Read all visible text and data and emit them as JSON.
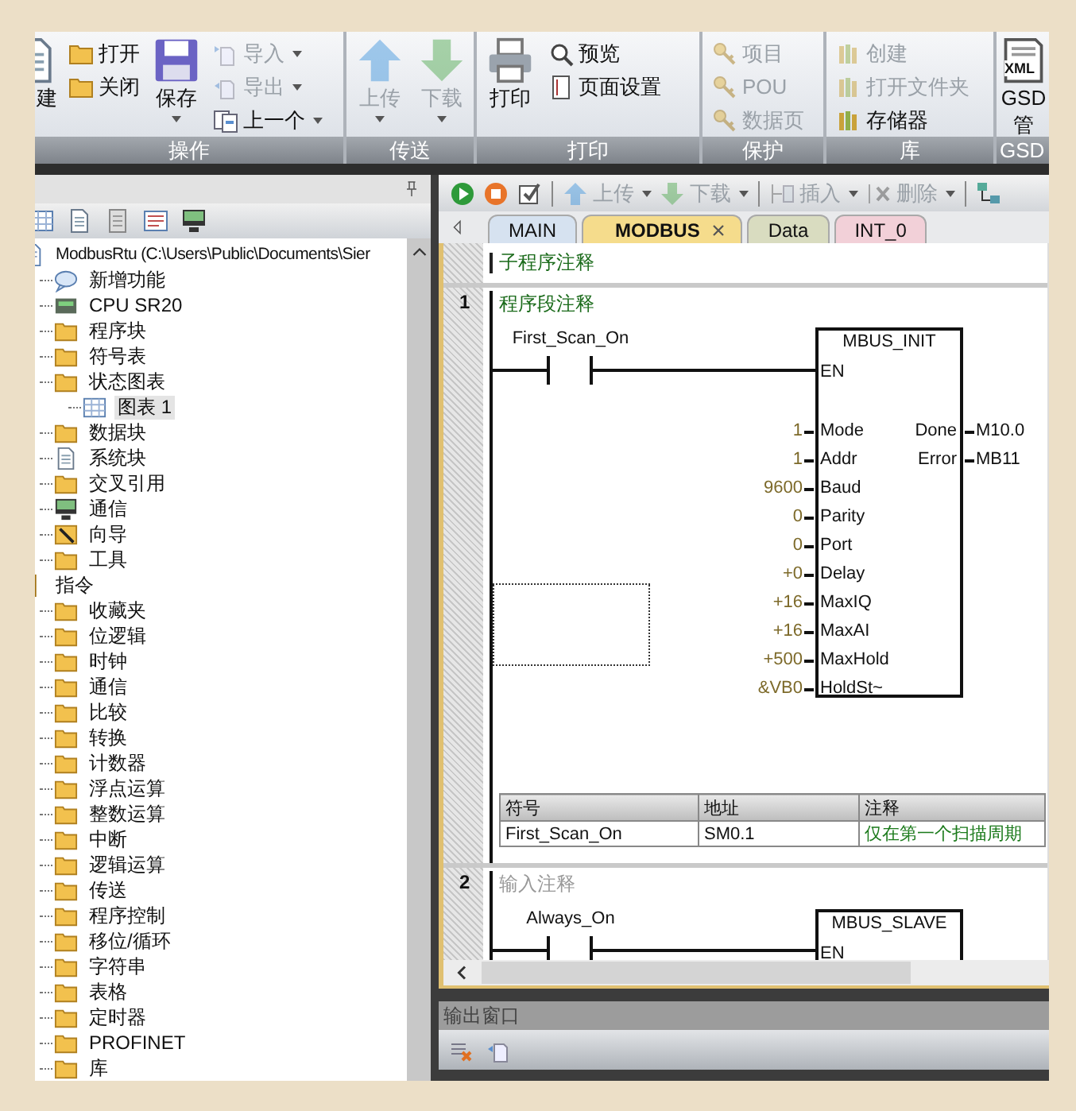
{
  "ribbon": {
    "groups": [
      {
        "label": "操作",
        "columns": [
          [
            {
              "kind": "document",
              "label": "建",
              "disabled": false,
              "dropdown": false
            }
          ],
          [
            {
              "kind": "folder",
              "label": "打开",
              "disabled": false,
              "dropdown": false
            },
            {
              "kind": "folder",
              "label": "关闭",
              "disabled": false,
              "dropdown": false
            }
          ],
          [
            {
              "kind": "save",
              "label": "保存",
              "disabled": false,
              "dropdown": true
            }
          ],
          [
            {
              "kind": "import",
              "label": "导入",
              "disabled": true,
              "dropdown": true
            },
            {
              "kind": "export",
              "label": "导出",
              "disabled": true,
              "dropdown": true
            },
            {
              "kind": "previous",
              "label": "上一个",
              "disabled": false,
              "dropdown": true
            }
          ]
        ]
      },
      {
        "label": "传送",
        "columns": [
          [
            {
              "kind": "upload",
              "label": "上传",
              "disabled": true,
              "dropdown": true
            }
          ],
          [
            {
              "kind": "download",
              "label": "下载",
              "disabled": true,
              "dropdown": true
            }
          ]
        ]
      },
      {
        "label": "打印",
        "columns": [
          [
            {
              "kind": "print",
              "label": "打印",
              "disabled": false,
              "dropdown": false
            }
          ],
          [
            {
              "kind": "preview",
              "label": "预览",
              "disabled": false,
              "dropdown": false
            },
            {
              "kind": "page_setup",
              "label": "页面设置",
              "disabled": false,
              "dropdown": false
            }
          ]
        ]
      },
      {
        "label": "保护",
        "columns": [
          [
            {
              "kind": "key",
              "label": "项目",
              "disabled": true,
              "dropdown": false
            },
            {
              "kind": "key",
              "label": "POU",
              "disabled": true,
              "dropdown": false
            },
            {
              "kind": "key",
              "label": "数据页",
              "disabled": true,
              "dropdown": false
            }
          ]
        ]
      },
      {
        "label": "库",
        "columns": [
          [
            {
              "kind": "books",
              "label": "创建",
              "disabled": true,
              "dropdown": false
            },
            {
              "kind": "books",
              "label": "打开文件夹",
              "disabled": true,
              "dropdown": false
            },
            {
              "kind": "books",
              "label": "存储器",
              "disabled": false,
              "dropdown": false
            }
          ]
        ]
      },
      {
        "label": "GSD",
        "columns": [
          [
            {
              "kind": "xml",
              "label": "GSD",
              "sublabel": "管",
              "badge": "XML",
              "disabled": false,
              "dropdown": false
            }
          ]
        ]
      }
    ]
  },
  "project_tree": {
    "items": [
      {
        "kind": "project",
        "label": "ModbusRtu (C:\\Users\\Public\\Documents\\Sier",
        "selected": false,
        "children": [
          {
            "kind": "help",
            "label": "新增功能",
            "selected": false
          },
          {
            "kind": "cpu",
            "label": "CPU SR20",
            "selected": false
          },
          {
            "kind": "folder",
            "label": "程序块",
            "selected": false
          },
          {
            "kind": "folder",
            "label": "符号表",
            "selected": false
          },
          {
            "kind": "folder",
            "label": "状态图表",
            "selected": false,
            "children": [
              {
                "kind": "table",
                "label": "图表 1",
                "selected": true
              }
            ]
          },
          {
            "kind": "folder",
            "label": "数据块",
            "selected": false
          },
          {
            "kind": "document",
            "label": "系统块",
            "selected": false
          },
          {
            "kind": "folder",
            "label": "交叉引用",
            "selected": false
          },
          {
            "kind": "monitor",
            "label": "通信",
            "selected": false
          },
          {
            "kind": "wand",
            "label": "向导",
            "selected": false
          },
          {
            "kind": "folder",
            "label": "工具",
            "selected": false
          }
        ]
      },
      {
        "kind": "category",
        "label": "指令",
        "selected": false,
        "children": [
          {
            "kind": "folder",
            "label": "收藏夹",
            "selected": false
          },
          {
            "kind": "folder",
            "label": "位逻辑",
            "selected": false
          },
          {
            "kind": "folder",
            "label": "时钟",
            "selected": false
          },
          {
            "kind": "folder",
            "label": "通信",
            "selected": false
          },
          {
            "kind": "folder",
            "label": "比较",
            "selected": false
          },
          {
            "kind": "folder",
            "label": "转换",
            "selected": false
          },
          {
            "kind": "folder",
            "label": "计数器",
            "selected": false
          },
          {
            "kind": "folder",
            "label": "浮点运算",
            "selected": false
          },
          {
            "kind": "folder",
            "label": "整数运算",
            "selected": false
          },
          {
            "kind": "folder",
            "label": "中断",
            "selected": false
          },
          {
            "kind": "folder",
            "label": "逻辑运算",
            "selected": false
          },
          {
            "kind": "folder",
            "label": "传送",
            "selected": false
          },
          {
            "kind": "folder",
            "label": "程序控制",
            "selected": false
          },
          {
            "kind": "folder",
            "label": "移位/循环",
            "selected": false
          },
          {
            "kind": "folder",
            "label": "字符串",
            "selected": false
          },
          {
            "kind": "folder",
            "label": "表格",
            "selected": false
          },
          {
            "kind": "folder",
            "label": "定时器",
            "selected": false
          },
          {
            "kind": "folder",
            "label": "PROFINET",
            "selected": false
          },
          {
            "kind": "folder",
            "label": "库",
            "selected": false
          }
        ]
      }
    ]
  },
  "editor_toolbar": [
    {
      "kind": "run",
      "disabled": false
    },
    {
      "kind": "stop",
      "disabled": false
    },
    {
      "kind": "compile",
      "disabled": false
    },
    {
      "kind": "separator"
    },
    {
      "kind": "upload",
      "label": "上传",
      "disabled": true,
      "dropdown": true
    },
    {
      "kind": "download",
      "label": "下载",
      "disabled": true,
      "dropdown": true
    },
    {
      "kind": "separator"
    },
    {
      "kind": "insert",
      "label": "插入",
      "disabled": true,
      "dropdown": true
    },
    {
      "kind": "delete",
      "label": "删除",
      "disabled": true,
      "dropdown": true
    },
    {
      "kind": "separator"
    },
    {
      "kind": "network",
      "disabled": false
    }
  ],
  "editor_tabs": [
    {
      "label": "MAIN",
      "selected": false,
      "closable": false,
      "color": "#d6e2f0"
    },
    {
      "label": "MODBUS",
      "selected": true,
      "closable": true,
      "color": "#f5dc8c"
    },
    {
      "label": "Data",
      "selected": false,
      "closable": false,
      "color": "#d9dcc0"
    },
    {
      "label": "INT_0",
      "selected": false,
      "closable": false,
      "color": "#f2d0d8"
    }
  ],
  "program": {
    "comment": "子程序注释",
    "networks": [
      {
        "number": "1",
        "comment": "程序段注释",
        "contact": "First_Scan_On",
        "selection_frame": true,
        "block": {
          "name": "MBUS_INIT",
          "enable": "EN",
          "inputs": [
            {
              "value": "1",
              "pin": "Mode"
            },
            {
              "value": "1",
              "pin": "Addr"
            },
            {
              "value": "9600",
              "pin": "Baud"
            },
            {
              "value": "0",
              "pin": "Parity"
            },
            {
              "value": "0",
              "pin": "Port"
            },
            {
              "value": "+0",
              "pin": "Delay"
            },
            {
              "value": "+16",
              "pin": "MaxIQ"
            },
            {
              "value": "+16",
              "pin": "MaxAI"
            },
            {
              "value": "+500",
              "pin": "MaxHold"
            },
            {
              "value": "&VB0",
              "pin": "HoldSt~"
            }
          ],
          "outputs": [
            {
              "pin": "Done",
              "value": "M10.0"
            },
            {
              "pin": "Error",
              "value": "MB11"
            }
          ]
        },
        "symbol_table": {
          "columns": [
            "符号",
            "地址",
            "注释"
          ],
          "rows": [
            [
              "First_Scan_On",
              "SM0.1",
              "仅在第一个扫描周期"
            ]
          ]
        }
      },
      {
        "number": "2",
        "placeholder": "输入注释",
        "contact": "Always_On",
        "block": {
          "name": "MBUS_SLAVE",
          "enable": "EN"
        }
      }
    ]
  },
  "output_window": {
    "title": "输出窗口",
    "tools": [
      {
        "kind": "clear"
      },
      {
        "kind": "export"
      }
    ]
  }
}
